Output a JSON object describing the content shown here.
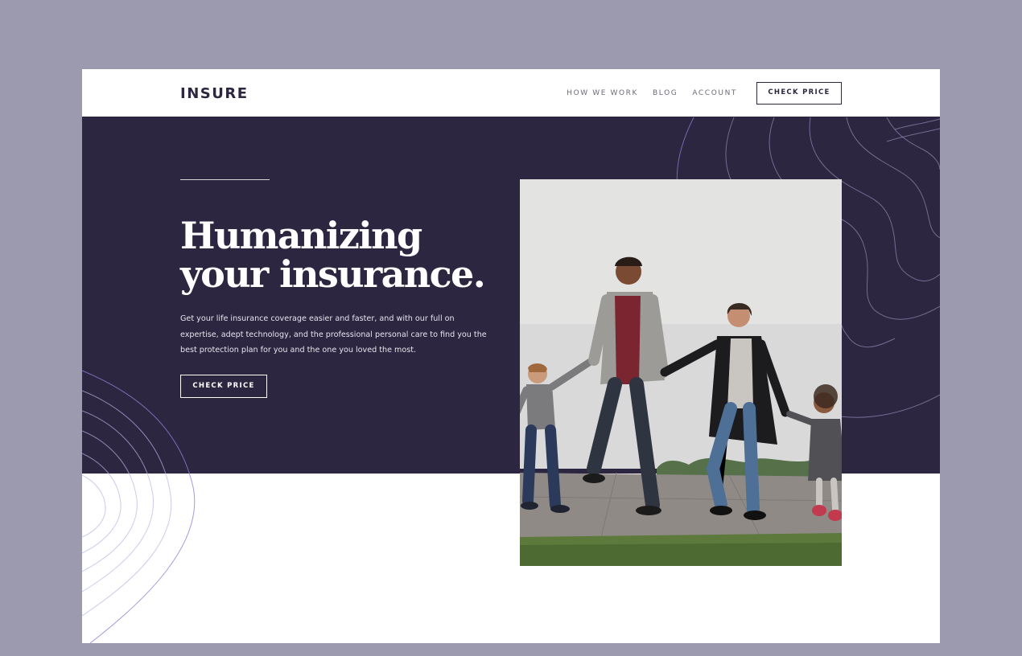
{
  "header": {
    "logo": "INSURE",
    "nav": [
      {
        "label": "HOW WE WORK"
      },
      {
        "label": "BLOG"
      },
      {
        "label": "ACCOUNT"
      }
    ],
    "cta_label": "CHECK PRICE"
  },
  "hero": {
    "title_line1": "Humanizing",
    "title_line2": "your insurance.",
    "description": "Get your life insurance coverage easier and faster, and with our full on expertise, adept technology, and the professional personal care to find you the best protection plan for you and the one you loved the most.",
    "cta_label": "CHECK PRICE",
    "image_icon": "family-photo"
  },
  "colors": {
    "page_background": "#9c9aaf",
    "hero_background": "#2d2640",
    "accent_lines": "#8a82d4",
    "text_dark": "#2d2640",
    "white": "#ffffff"
  }
}
